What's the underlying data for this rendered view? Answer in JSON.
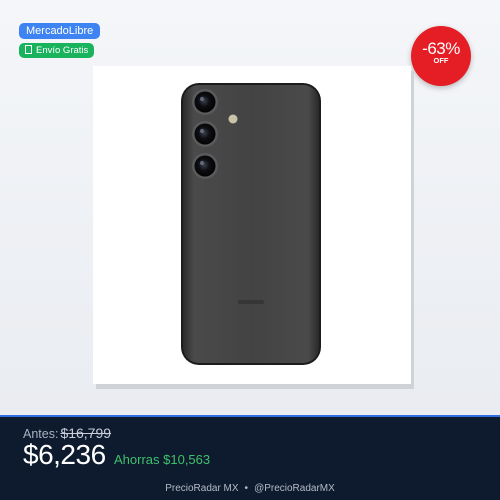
{
  "badges": {
    "store": "MercadoLibre",
    "shipping": "Envío Gratis",
    "shipping_icon": "box-icon"
  },
  "discount": {
    "percent": "-63%",
    "off": "OFF",
    "color": "#e51d24"
  },
  "product": {
    "image": "black-smartphone-back-with-triple-camera",
    "phone_color": "#3f3f40"
  },
  "pricing": {
    "before_label": "Antes:",
    "before_price": "$16,799",
    "price": "$6,236",
    "savings": "Ahorras $10,563",
    "savings_color": "#3fc16b"
  },
  "footer": {
    "brand": "PrecioRadar MX",
    "separator": "•",
    "handle": "@PrecioRadarMX"
  }
}
